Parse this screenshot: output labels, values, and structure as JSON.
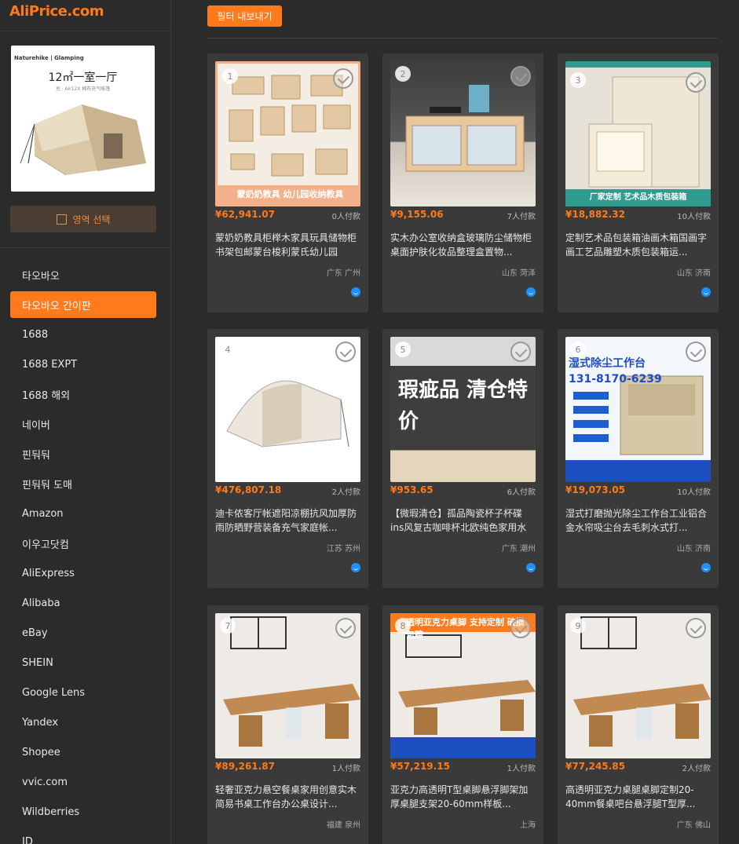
{
  "brand": {
    "logo_text": "AliPrice.com"
  },
  "query_image": {
    "brand_text": "Naturehike | Glamping",
    "headline": "12㎡一室一厅",
    "subline": "亘 · Air12X 棉布充气帐篷"
  },
  "sidebar": {
    "region_select_label": "영역 선택",
    "sites": [
      {
        "label": "타오바오",
        "active": false
      },
      {
        "label": "타오바오 간이판",
        "active": true
      },
      {
        "label": "1688",
        "active": false
      },
      {
        "label": "1688 EXPT",
        "active": false
      },
      {
        "label": "1688 해외",
        "active": false
      },
      {
        "label": "네이버",
        "active": false
      },
      {
        "label": "핀둬둬",
        "active": false
      },
      {
        "label": "핀둬둬 도매",
        "active": false
      },
      {
        "label": "Amazon",
        "active": false
      },
      {
        "label": "이우고닷컴",
        "active": false
      },
      {
        "label": "AliExpress",
        "active": false
      },
      {
        "label": "Alibaba",
        "active": false
      },
      {
        "label": "eBay",
        "active": false
      },
      {
        "label": "SHEIN",
        "active": false
      },
      {
        "label": "Google Lens",
        "active": false
      },
      {
        "label": "Yandex",
        "active": false
      },
      {
        "label": "Shopee",
        "active": false
      },
      {
        "label": "vvic.com",
        "active": false
      },
      {
        "label": "Wildberries",
        "active": false
      },
      {
        "label": "JD",
        "active": false
      }
    ]
  },
  "toolbar": {
    "filter_export_label": "필터 내보내기"
  },
  "colors": {
    "accent": "#ff7a1a",
    "background": "#2b2b2b",
    "card": "#3a3a3a"
  },
  "products": [
    {
      "index": "1",
      "price": "¥62,941.07",
      "sold": "0人付款",
      "title": "蒙奶奶教具柜榉木家具玩具储物柜书架包邮蒙台梭利蒙氏幼儿园",
      "location": "广东 广州",
      "thumb_text": "蒙奶奶教具 幼儿园收纳教具"
    },
    {
      "index": "2",
      "price": "¥9,155.06",
      "sold": "7人付款",
      "title": "实木办公室收纳盒玻璃防尘储物柜桌面护肤化妆品整理盒置物...",
      "location": "山东 菏泽",
      "thumb_text": ""
    },
    {
      "index": "3",
      "price": "¥18,882.32",
      "sold": "10人付款",
      "title": "定制艺术品包装箱油画木箱国画字画工艺品雕塑木质包装箱运...",
      "location": "山东 济南",
      "thumb_text": "厂家定制 艺术品木质包装箱"
    },
    {
      "index": "4",
      "price": "¥476,807.18",
      "sold": "2人付款",
      "title": "迪卡侬客厅帐遮阳凉棚抗风加厚防雨防晒野营装备充气家庭帐...",
      "location": "江苏 苏州",
      "thumb_text": ""
    },
    {
      "index": "5",
      "price": "¥953.65",
      "sold": "6人付款",
      "title": "【微瑕清仓】孤品陶瓷杯子杯碟ins风复古咖啡杯北欧纯色家用水杯",
      "location": "广东 潮州",
      "thumb_text": "瑕疵品 清仓特价"
    },
    {
      "index": "6",
      "price": "¥19,073.05",
      "sold": "10人付款",
      "title": "湿式打磨抛光除尘工作台工业铝合金水帘吸尘台去毛刺水式打...",
      "location": "山东 济南",
      "thumb_text": "湿式除尘工作台 131-8170-6239"
    },
    {
      "index": "7",
      "price": "¥89,261.87",
      "sold": "1人付款",
      "title": "轻奢亚克力悬空餐桌家用创意实木简易书桌工作台办公桌设计...",
      "location": "福建 泉州",
      "thumb_text": ""
    },
    {
      "index": "8",
      "price": "¥57,219.15",
      "sold": "1人付款",
      "title": "亚克力高透明T型桌脚悬浮脚架加厚桌腿支架20-60mm样板...",
      "location": "上海",
      "thumb_text": "透明亚克力桌脚 支持定制 破损包赔"
    },
    {
      "index": "9",
      "price": "¥77,245.85",
      "sold": "2人付款",
      "title": "高透明亚克力桌腿桌脚定制20-40mm餐桌吧台悬浮腿T型厚...",
      "location": "广东 佛山",
      "thumb_text": ""
    }
  ]
}
